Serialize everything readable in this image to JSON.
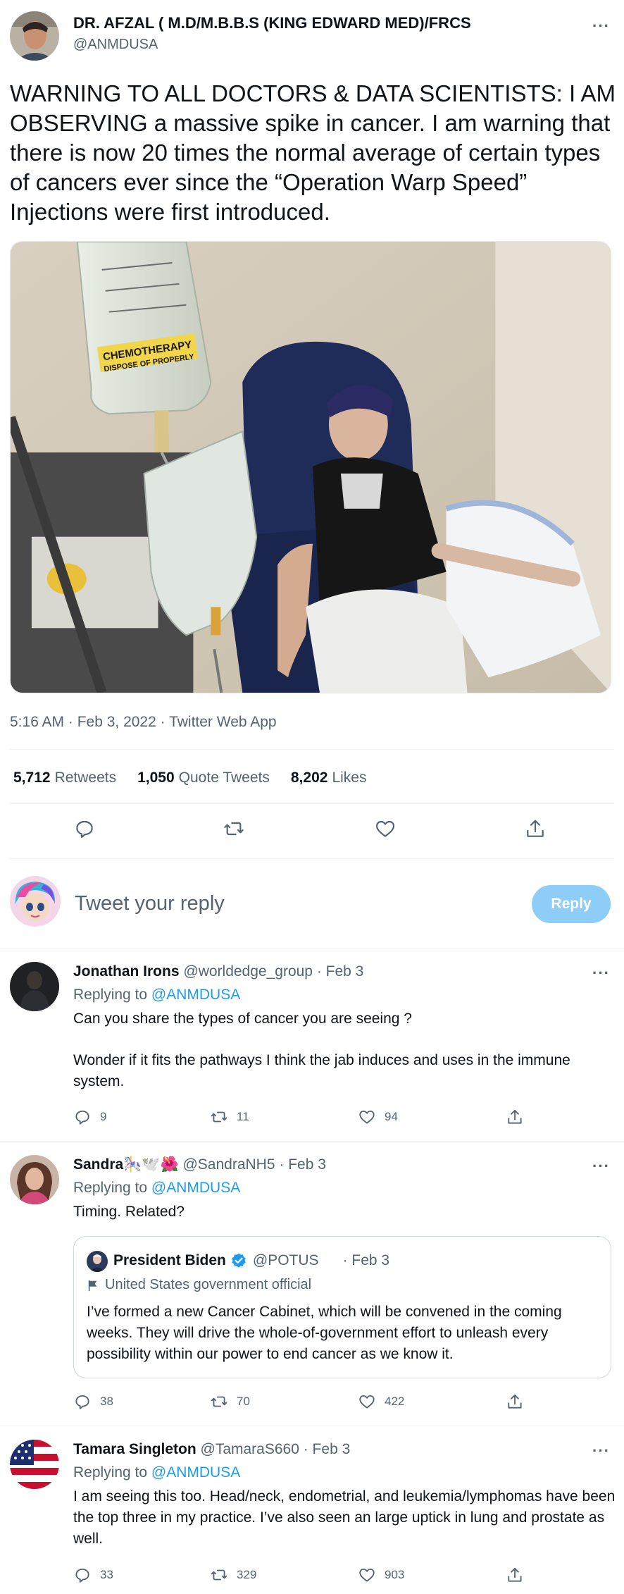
{
  "main_tweet": {
    "author_name": "DR. AFZAL ( M.D/M.B.B.S (KING EDWARD MED)/FRCS",
    "author_handle": "@ANMDUSA",
    "text": "WARNING TO ALL DOCTORS & DATA SCIENTISTS: I AM OBSERVING a massive spike in cancer. I am warning that there is now 20 times the normal average of certain types of cancers ever since the “Operation Warp Speed” Injections were first introduced.",
    "media_bag_label": "CHEMOTHERAPY",
    "media_bag_sublabel": "DISPOSE OF PROPERLY",
    "meta": "5:16 AM · Feb 3, 2022 · Twitter Web App",
    "retweets_count": "5,712",
    "retweets_label": "Retweets",
    "quote_tweets_count": "1,050",
    "quote_tweets_label": "Quote Tweets",
    "likes_count": "8,202",
    "likes_label": "Likes",
    "actions": [
      "reply-icon",
      "retweet-icon",
      "like-icon",
      "share-icon"
    ]
  },
  "reply_composer": {
    "placeholder": "Tweet your reply",
    "button_label": "Reply",
    "button_color": "#8ecdf8"
  },
  "replies": [
    {
      "name": "Jonathan Irons",
      "handle": "@worldedge_group",
      "date": "· Feb 3",
      "replying_prefix": "Replying to",
      "replying_to": "@ANMDUSA",
      "text": "Can you share the types of cancer you are seeing ?",
      "text2": "Wonder if it fits the pathways I think the jab induces and uses in the immune system.",
      "replies": "9",
      "retweets": "11",
      "likes": "94"
    },
    {
      "name": "Sandra🎠🕊️🌺",
      "handle": "@SandraNH5",
      "date": "· Feb 3",
      "replying_prefix": "Replying to",
      "replying_to": "@ANMDUSA",
      "text": "Timing. Related?",
      "quote": {
        "name": "President Biden",
        "handle": "@POTUS",
        "date": "· Feb 3",
        "label": "United States government official",
        "text": "I’ve formed a new Cancer Cabinet, which will be convened in the coming weeks. They will drive the whole-of-government effort to unleash every possibility within our power to end cancer as we know it."
      },
      "replies": "38",
      "retweets": "70",
      "likes": "422"
    },
    {
      "name": "Tamara Singleton",
      "handle": "@TamaraS660",
      "date": "· Feb 3",
      "replying_prefix": "Replying to",
      "replying_to": "@ANMDUSA",
      "text": "I am seeing this too. Head/neck, endometrial, and leukemia/lymphomas have been the top three in my practice. I’ve also seen an large uptick in lung and prostate as well.",
      "replies": "33",
      "retweets": "329",
      "likes": "903"
    }
  ],
  "colors": {
    "link": "#1d9bf0",
    "secondary_text": "#536471",
    "verified": "#1d9bf0"
  }
}
